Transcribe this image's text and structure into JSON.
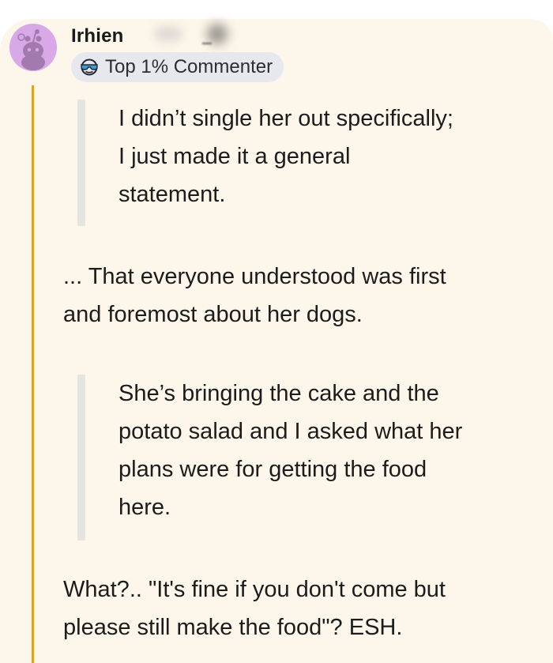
{
  "comment": {
    "author": "Irhien",
    "flair": "Top 1% Commenter",
    "quote_1": [
      "I didn’t single her out specifically;",
      "I just made it a general",
      "statement."
    ],
    "reply_1": [
      "... That everyone understood was first",
      "and foremost about her dogs."
    ],
    "quote_2": [
      "She’s bringing the cake and the",
      "potato salad and I asked what her",
      "plans were for getting the food",
      "here."
    ],
    "reply_2": [
      "What?.. \"It's fine if you don't come but",
      "please still make the food\"? ESH."
    ]
  },
  "colors": {
    "card_background": "#fcf7ea",
    "avatar_background": "#d9a8e6",
    "thread_line": "#d6a62a",
    "quote_bar": "#e6e4df",
    "badge_background": "#e7e8ee"
  }
}
